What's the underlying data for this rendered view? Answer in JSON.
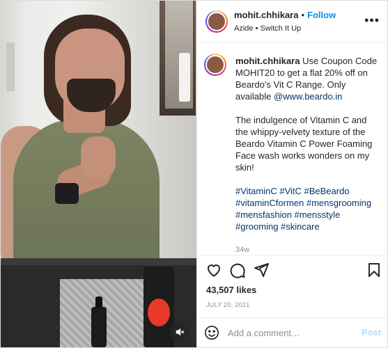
{
  "header": {
    "username": "mohit.chhikara",
    "separator": "•",
    "follow_label": "Follow",
    "audio": "Azide • Switch It Up",
    "more_icon": "more-horizontal-icon"
  },
  "caption": {
    "username": "mohit.chhikara",
    "text1": "Use Coupon Code MOHIT20 to get a flat 20% off on Beardo's Vit C Range. Only available ",
    "link": "@www.beardo.in",
    "text2": "The indulgence of Vitamin C and the whippy-velvety texture of the Beardo Vitamin C Power Foaming Face wash works wonders on my skin!",
    "hashtags": "#VitaminC #VitC #BeBeardo #vitaminCformen #mensgrooming #mensfashion #mensstyle #grooming #skincare",
    "time": "34w"
  },
  "actions": {
    "like_icon": "heart-icon",
    "comment_icon": "comment-icon",
    "share_icon": "send-icon",
    "save_icon": "bookmark-icon"
  },
  "likes": "43,507 likes",
  "date": "JULY 20, 2021",
  "comment": {
    "placeholder": "Add a comment…",
    "post_label": "Post",
    "emoji_icon": "smiley-icon"
  },
  "media": {
    "mute_icon": "speaker-muted-icon"
  },
  "colors": {
    "accent": "#0095f6",
    "link": "#00376b",
    "muted": "#8e8e8e",
    "post_disabled": "#b2dffc"
  }
}
